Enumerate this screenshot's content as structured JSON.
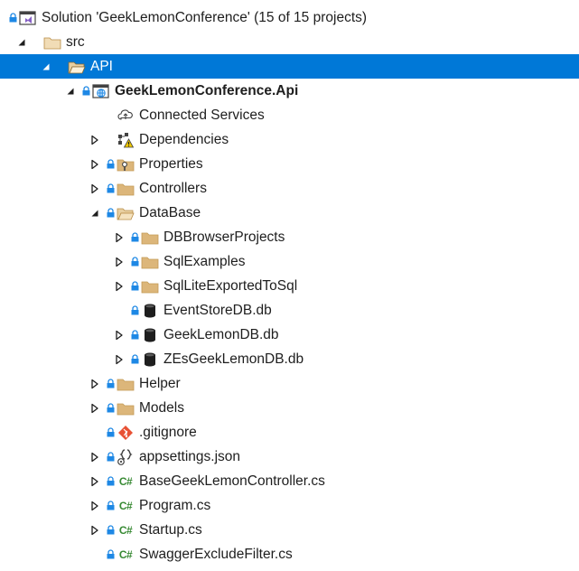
{
  "colors": {
    "selection": "#0078d7",
    "folder": "#dcb67a",
    "lock": "#1e88e5",
    "csharp": "#388a34",
    "git": "#e85134",
    "warning": "#f0c800"
  },
  "tree": {
    "rows": [
      {
        "label": "Solution 'GeekLemonConference' (15 of 15 projects)",
        "icon": "solution-icon",
        "depth": 0,
        "expander": "none",
        "lock": true,
        "selected": false,
        "bold": false
      },
      {
        "label": "src",
        "icon": "solution-folder-icon",
        "depth": 1,
        "expander": "expanded",
        "lock": false,
        "selected": false,
        "bold": false
      },
      {
        "label": "API",
        "icon": "solution-folder-open-icon",
        "depth": 2,
        "expander": "expanded",
        "lock": false,
        "selected": true,
        "bold": false
      },
      {
        "label": "GeekLemonConference.Api",
        "icon": "web-project-icon",
        "depth": 3,
        "expander": "expanded",
        "lock": true,
        "selected": false,
        "bold": true
      },
      {
        "label": "Connected Services",
        "icon": "connected-services-icon",
        "depth": 4,
        "expander": "none",
        "lock": false,
        "selected": false,
        "bold": false
      },
      {
        "label": "Dependencies",
        "icon": "dependencies-warning-icon",
        "depth": 4,
        "expander": "collapsed",
        "lock": false,
        "selected": false,
        "bold": false
      },
      {
        "label": "Properties",
        "icon": "properties-icon",
        "depth": 4,
        "expander": "collapsed",
        "lock": true,
        "selected": false,
        "bold": false
      },
      {
        "label": "Controllers",
        "icon": "folder-icon",
        "depth": 4,
        "expander": "collapsed",
        "lock": true,
        "selected": false,
        "bold": false
      },
      {
        "label": "DataBase",
        "icon": "folder-open-icon",
        "depth": 4,
        "expander": "expanded",
        "lock": true,
        "selected": false,
        "bold": false
      },
      {
        "label": "DBBrowserProjects",
        "icon": "folder-icon",
        "depth": 5,
        "expander": "collapsed",
        "lock": true,
        "selected": false,
        "bold": false
      },
      {
        "label": "SqlExamples",
        "icon": "folder-icon",
        "depth": 5,
        "expander": "collapsed",
        "lock": true,
        "selected": false,
        "bold": false
      },
      {
        "label": "SqlLiteExportedToSql",
        "icon": "folder-icon",
        "depth": 5,
        "expander": "collapsed",
        "lock": true,
        "selected": false,
        "bold": false
      },
      {
        "label": "EventStoreDB.db",
        "icon": "database-icon",
        "depth": 5,
        "expander": "none",
        "lock": true,
        "selected": false,
        "bold": false
      },
      {
        "label": "GeekLemonDB.db",
        "icon": "database-icon",
        "depth": 5,
        "expander": "collapsed",
        "lock": true,
        "selected": false,
        "bold": false
      },
      {
        "label": "ZEsGeekLemonDB.db",
        "icon": "database-icon",
        "depth": 5,
        "expander": "collapsed",
        "lock": true,
        "selected": false,
        "bold": false
      },
      {
        "label": "Helper",
        "icon": "folder-icon",
        "depth": 4,
        "expander": "collapsed",
        "lock": true,
        "selected": false,
        "bold": false
      },
      {
        "label": "Models",
        "icon": "folder-icon",
        "depth": 4,
        "expander": "collapsed",
        "lock": true,
        "selected": false,
        "bold": false
      },
      {
        "label": ".gitignore",
        "icon": "git-icon",
        "depth": 4,
        "expander": "none",
        "lock": true,
        "selected": false,
        "bold": false
      },
      {
        "label": "appsettings.json",
        "icon": "json-settings-icon",
        "depth": 4,
        "expander": "collapsed",
        "lock": true,
        "selected": false,
        "bold": false
      },
      {
        "label": "BaseGeekLemonController.cs",
        "icon": "csharp-file-icon",
        "depth": 4,
        "expander": "collapsed",
        "lock": true,
        "selected": false,
        "bold": false
      },
      {
        "label": "Program.cs",
        "icon": "csharp-file-icon",
        "depth": 4,
        "expander": "collapsed",
        "lock": true,
        "selected": false,
        "bold": false
      },
      {
        "label": "Startup.cs",
        "icon": "csharp-file-icon",
        "depth": 4,
        "expander": "collapsed",
        "lock": true,
        "selected": false,
        "bold": false
      },
      {
        "label": "SwaggerExcludeFilter.cs",
        "icon": "csharp-file-icon",
        "depth": 4,
        "expander": "none",
        "lock": true,
        "selected": false,
        "bold": false
      }
    ]
  }
}
